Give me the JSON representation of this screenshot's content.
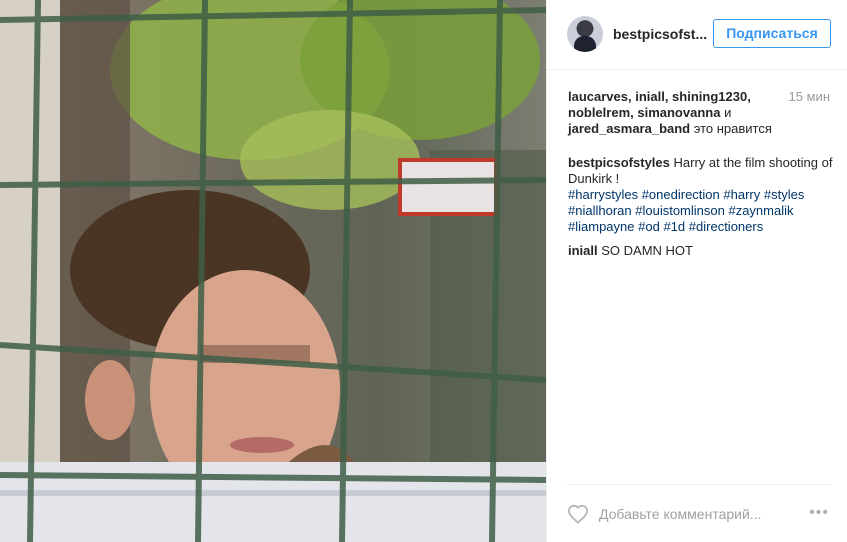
{
  "photo": {
    "icon": "photo-of-person-behind-fence"
  },
  "header": {
    "username": "bestpicsofst...",
    "follow_label": "Подписаться"
  },
  "likes": {
    "names": "laucarves, iniall, shining1230, noblelrem, simanovanna",
    "conjunction": "и",
    "last_name": "jared_asmara_band",
    "suffix": "это нравится",
    "time": "15 мин"
  },
  "caption": {
    "author": "bestpicsofstyles",
    "text": "Harry at the film shooting of Dunkirk !",
    "hashtags": [
      "#harrystyles",
      "#onedirection",
      "#harry",
      "#styles",
      "#niallhoran",
      "#louistomlinson",
      "#zaynmalik",
      "#liampayne",
      "#od",
      "#1d",
      "#directioners"
    ]
  },
  "comment": {
    "author": "iniall",
    "text": "SO DAMN HOT"
  },
  "footer": {
    "placeholder": "Добавьте комментарий...",
    "more": "•••"
  },
  "colors": {
    "accent": "#3897f0",
    "hashtag": "#003569",
    "muted": "#999999"
  }
}
